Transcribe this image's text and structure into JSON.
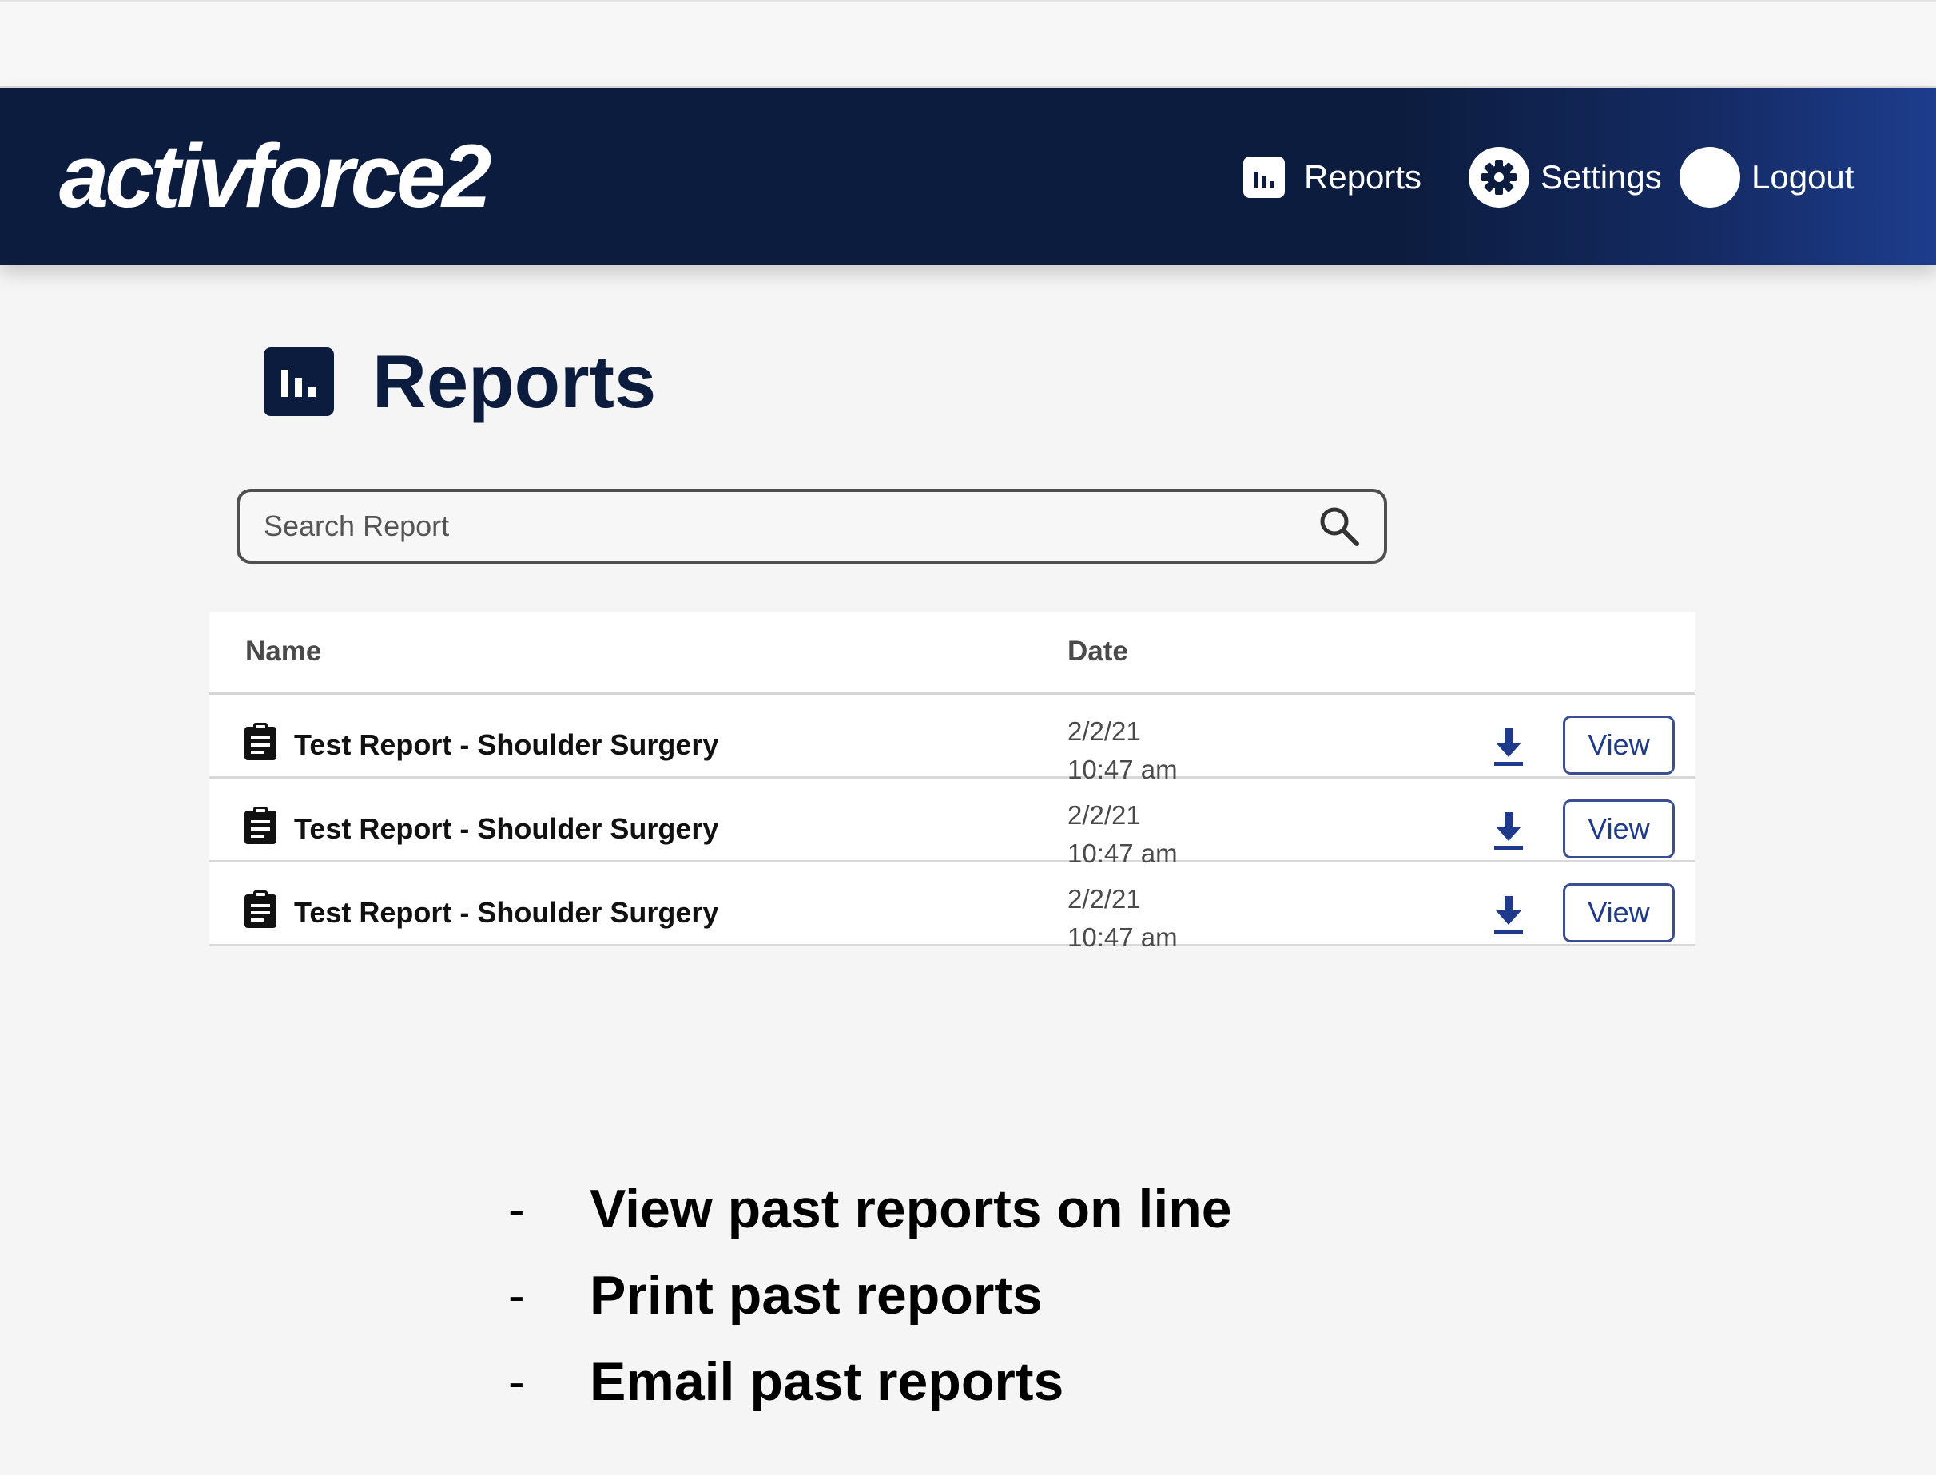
{
  "header": {
    "brand": "activforce2",
    "nav": {
      "reports_label": "Reports",
      "settings_label": "Settings",
      "logout_label": "Logout"
    },
    "colors": {
      "navbar": "#0c1c3e",
      "accent": "#1f3a8a"
    }
  },
  "page": {
    "title": "Reports",
    "title_icon": "bar-chart-icon"
  },
  "search": {
    "placeholder": "Search Report",
    "value": "",
    "icon": "search-icon"
  },
  "table": {
    "columns": {
      "name": "Name",
      "date": "Date"
    },
    "rows": [
      {
        "name": "Test Report - Shoulder Surgery",
        "date": "2/2/21",
        "time": "10:47 am",
        "view_label": "View",
        "icon": "clipboard-icon",
        "action_icon": "download-icon"
      },
      {
        "name": "Test Report - Shoulder Surgery",
        "date": "2/2/21",
        "time": "10:47 am",
        "view_label": "View",
        "icon": "clipboard-icon",
        "action_icon": "download-icon"
      },
      {
        "name": "Test Report - Shoulder Surgery",
        "date": "2/2/21",
        "time": "10:47 am",
        "view_label": "View",
        "icon": "clipboard-icon",
        "action_icon": "download-icon"
      }
    ]
  },
  "notes": {
    "bullet": "-",
    "items": [
      "View past reports on line",
      "Print past reports",
      "Email past reports"
    ]
  }
}
